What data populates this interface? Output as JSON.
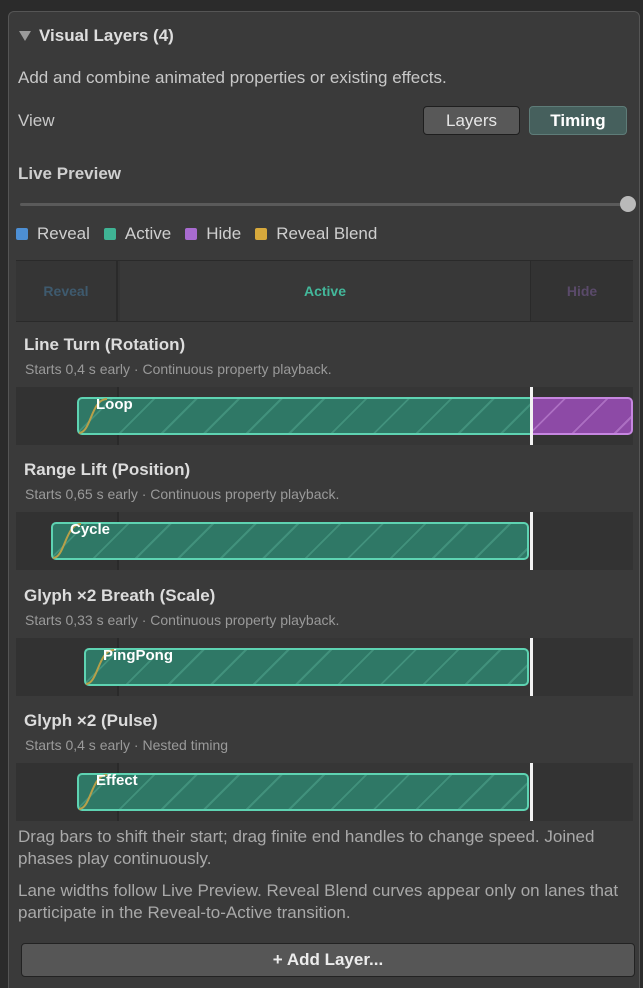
{
  "section": {
    "title": "Visual Layers (4)",
    "description": "Add and combine animated properties or existing effects."
  },
  "view": {
    "label": "View",
    "buttons": {
      "layers": "Layers",
      "timing": "Timing"
    },
    "selected": "Timing"
  },
  "live_preview": {
    "label": "Live Preview",
    "value": 1.0
  },
  "legend": [
    {
      "label": "Reveal",
      "color": "#4d8fd4"
    },
    {
      "label": "Active",
      "color": "#3fb394"
    },
    {
      "label": "Hide",
      "color": "#a86bd0"
    },
    {
      "label": "Reveal Blend",
      "color": "#d7a93c"
    }
  ],
  "phases": {
    "reveal": "Reveal",
    "active": "Active",
    "hide": "Hide"
  },
  "layers": [
    {
      "title": "Line Turn (Rotation)",
      "subtitle": "Starts 0,4 s early · Continuous property playback.",
      "bar_label": "Loop"
    },
    {
      "title": "Range Lift (Position)",
      "subtitle": "Starts 0,65 s early · Continuous property playback.",
      "bar_label": "Cycle"
    },
    {
      "title": "Glyph ×2 Breath (Scale)",
      "subtitle": "Starts 0,33 s early · Continuous property playback.",
      "bar_label": "PingPong"
    },
    {
      "title": "Glyph ×2 (Pulse)",
      "subtitle": "Starts 0,4 s early · Nested timing",
      "bar_label": "Effect"
    }
  ],
  "help": {
    "line1": "Drag bars to shift their start; drag finite end handles to change speed. Joined phases play continuously.",
    "line2": "Lane widths follow Live Preview. Reveal Blend curves appear only on lanes that participate in the Reveal-to-Active transition."
  },
  "add_button": "+ Add Layer..."
}
